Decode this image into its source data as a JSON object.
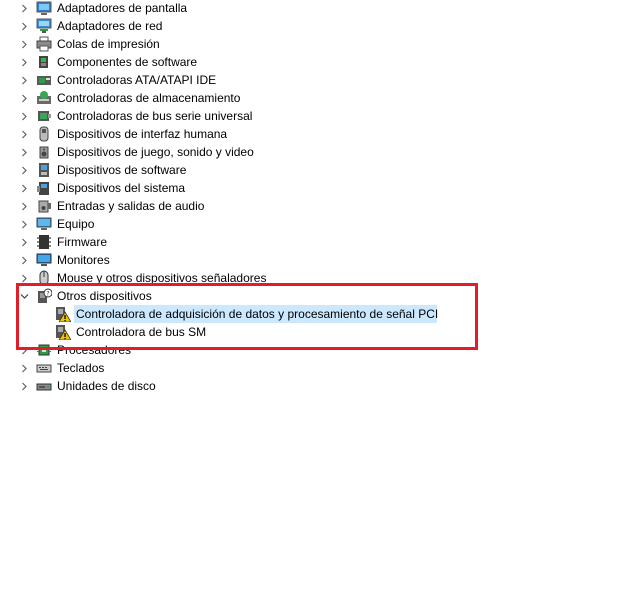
{
  "tree": {
    "categories": [
      {
        "label": "Adaptadores de pantalla",
        "icon": "display-adapter-icon",
        "expanded": false
      },
      {
        "label": "Adaptadores de red",
        "icon": "network-adapter-icon",
        "expanded": false
      },
      {
        "label": "Colas de impresión",
        "icon": "printer-icon",
        "expanded": false
      },
      {
        "label": "Componentes de software",
        "icon": "software-component-icon",
        "expanded": false
      },
      {
        "label": "Controladoras ATA/ATAPI IDE",
        "icon": "ide-controller-icon",
        "expanded": false
      },
      {
        "label": "Controladoras de almacenamiento",
        "icon": "storage-controller-icon",
        "expanded": false
      },
      {
        "label": "Controladoras de bus serie universal",
        "icon": "usb-controller-icon",
        "expanded": false
      },
      {
        "label": "Dispositivos de interfaz humana",
        "icon": "hid-icon",
        "expanded": false
      },
      {
        "label": "Dispositivos de juego, sonido y video",
        "icon": "speaker-icon",
        "expanded": false
      },
      {
        "label": "Dispositivos de software",
        "icon": "software-device-icon",
        "expanded": false
      },
      {
        "label": "Dispositivos del sistema",
        "icon": "system-device-icon",
        "expanded": false
      },
      {
        "label": "Entradas y salidas de audio",
        "icon": "audio-io-icon",
        "expanded": false
      },
      {
        "label": "Equipo",
        "icon": "computer-icon",
        "expanded": false
      },
      {
        "label": "Firmware",
        "icon": "firmware-icon",
        "expanded": false
      },
      {
        "label": "Monitores",
        "icon": "monitor-icon",
        "expanded": false
      },
      {
        "label": "Mouse y otros dispositivos señaladores",
        "icon": "mouse-icon",
        "expanded": false
      },
      {
        "label": "Otros dispositivos",
        "icon": "unknown-device-icon",
        "expanded": true,
        "children": [
          {
            "label": "Controladora de adquisición de datos y procesamiento de señal PCI",
            "icon": "warning-device-icon",
            "selected": true
          },
          {
            "label": "Controladora de bus SM",
            "icon": "warning-device-icon",
            "selected": false
          }
        ]
      },
      {
        "label": "Procesadores",
        "icon": "processor-icon",
        "expanded": false
      },
      {
        "label": "Teclados",
        "icon": "keyboard-icon",
        "expanded": false
      },
      {
        "label": "Unidades de disco",
        "icon": "disk-drive-icon",
        "expanded": false
      }
    ]
  },
  "colors": {
    "selection": "#cce8ff",
    "highlight_border": "#e11d2a",
    "warning": "#f2c200"
  }
}
